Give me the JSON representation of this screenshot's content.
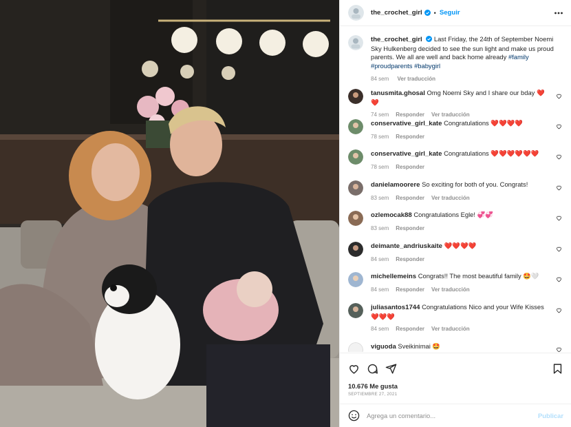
{
  "post": {
    "username": "the_crochet_girl",
    "follow_label": "Seguir",
    "dot": "•",
    "caption": {
      "text": "Last Friday, the 24th of September Noemi Sky Hulkenberg decided to see the sun light and make us proud parents. We all are well and back home already",
      "hashtags": [
        "#family",
        "#proudparents",
        "#babygirl"
      ],
      "time": "84 sem",
      "translate": "Ver traducción"
    }
  },
  "comments": [
    {
      "user": "tanusmita.ghosal",
      "text": "Omg Noemi Sky and I share our bday ❤️❤️",
      "time": "74 sem",
      "reply": "Responder",
      "translate": "Ver traducción",
      "avatar_color": "#3b2f2a"
    },
    {
      "user": "conservative_girl_kate",
      "text": "Congratulations ❤️❤️❤️❤️",
      "time": "78 sem",
      "reply": "Responder",
      "avatar_color": "#6d8c6a"
    },
    {
      "user": "conservative_girl_kate",
      "text": "Congratulations ❤️❤️❤️❤️❤️❤️",
      "time": "78 sem",
      "reply": "Responder",
      "avatar_color": "#6d8c6a"
    },
    {
      "user": "danielamoorere",
      "text": "So exciting for both of you. Congrats!",
      "time": "83 sem",
      "reply": "Responder",
      "translate": "Ver traducción",
      "avatar_color": "#7a6e6a"
    },
    {
      "user": "ozlemocak88",
      "text": "Congratulations Egle! 💞💞",
      "time": "83 sem",
      "reply": "Responder",
      "avatar_color": "#8a6b55"
    },
    {
      "user": "deimante_andriuskaite",
      "text": "❤️❤️❤️❤️",
      "time": "84 sem",
      "reply": "Responder",
      "avatar_color": "#2c2c2c"
    },
    {
      "user": "michellemeins",
      "text": "Congrats!! The most beautiful family 🤩🤍",
      "time": "84 sem",
      "reply": "Responder",
      "translate": "Ver traducción",
      "avatar_color": "#9fb6d1"
    },
    {
      "user": "juliasantos1744",
      "text": "Congratulations Nico and your Wife Kisses❤️❤️❤️",
      "time": "84 sem",
      "reply": "Responder",
      "translate": "Ver traducción",
      "avatar_color": "#55605a"
    },
    {
      "user": "viguoda",
      "text": "Sveikinimai 🤩",
      "time": "",
      "reply": "",
      "avatar_color": "#e8e8e8"
    }
  ],
  "footer": {
    "likes": "10.676 Me gusta",
    "date": "SEPTIEMBRE 27, 2021",
    "comment_placeholder": "Agrega un comentario...",
    "publish_label": "Publicar"
  },
  "colors": {
    "accent": "#0095f6",
    "hashtag": "#00376b",
    "muted": "#8e8e8e",
    "publish_disabled": "#b2dffc",
    "like_heart": "#ed4956"
  },
  "icons": {
    "header": [
      "verified-badge-icon",
      "more-options-icon"
    ],
    "actions": [
      "heart-icon",
      "comment-icon",
      "share-icon",
      "bookmark-icon"
    ],
    "composer": [
      "emoji-icon"
    ]
  }
}
